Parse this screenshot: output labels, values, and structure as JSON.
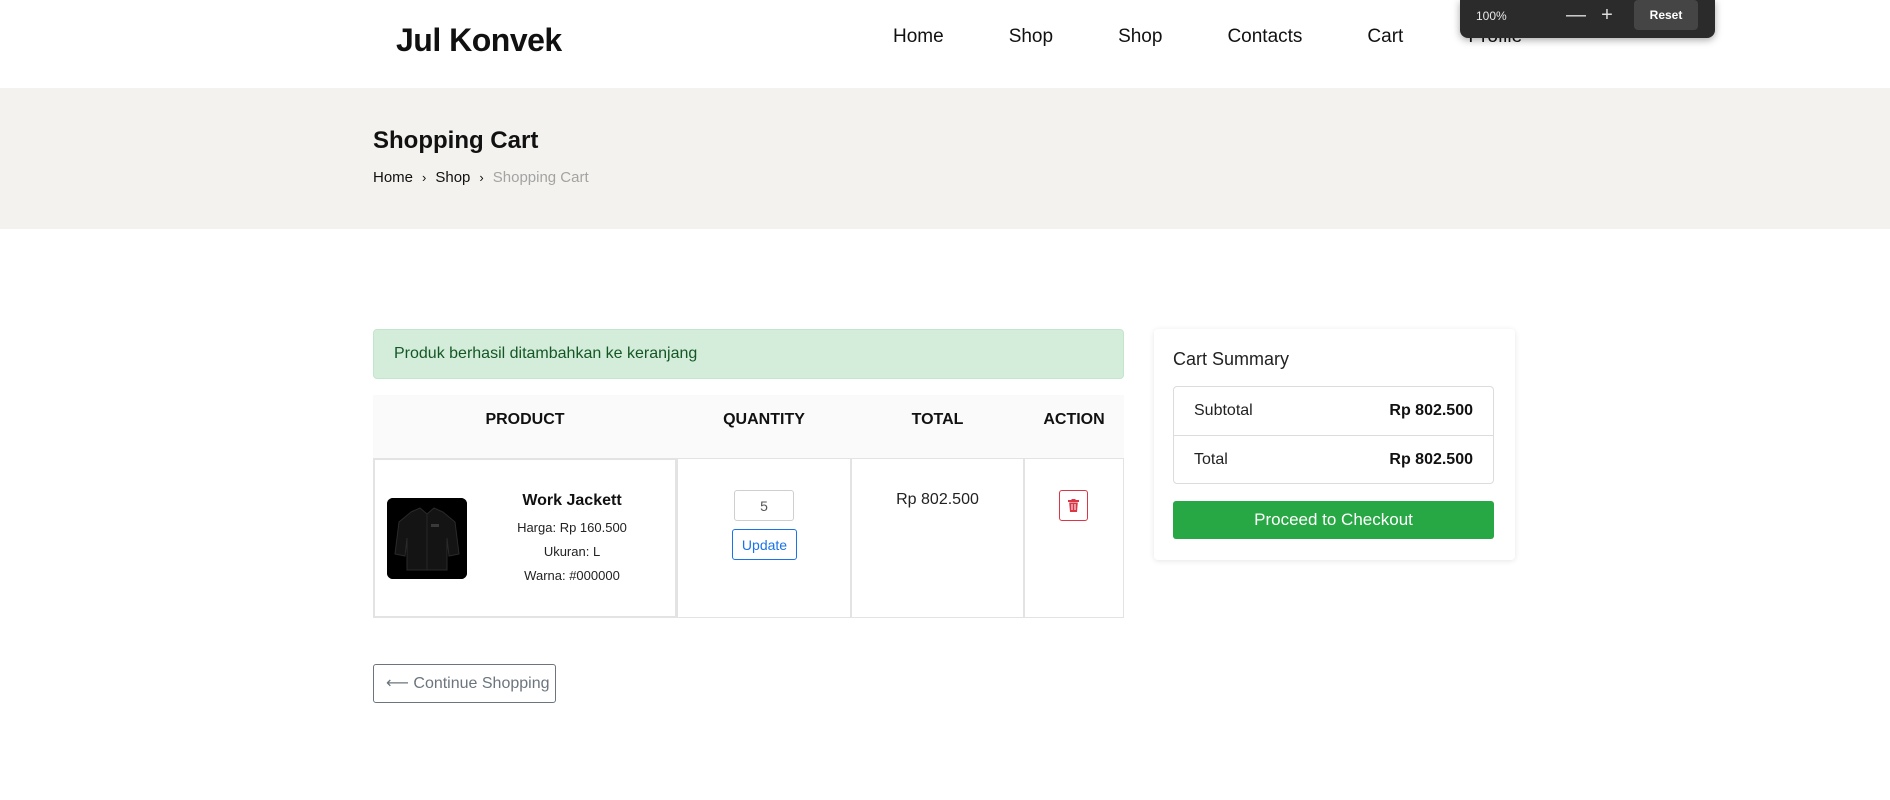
{
  "header": {
    "logo": "Jul Konvek",
    "nav": [
      "Home",
      "Shop",
      "Shop",
      "Contacts",
      "Cart",
      "Profile"
    ]
  },
  "zoom": {
    "level": "100%",
    "minus": "—",
    "plus": "+",
    "reset": "Reset"
  },
  "banner": {
    "title": "Shopping Cart",
    "breadcrumb": [
      "Home",
      "Shop",
      "Shopping Cart"
    ],
    "sep": "›"
  },
  "alert": "Produk berhasil ditambahkan ke keranjang",
  "table": {
    "headers": [
      "PRODUCT",
      "QUANTITY",
      "TOTAL",
      "ACTION"
    ],
    "rows": [
      {
        "name": "Work Jackett",
        "price": "Harga: Rp 160.500",
        "size": "Ukuran: L",
        "color": "Warna: #000000",
        "quantity": "5",
        "update": "Update",
        "total": "Rp 802.500",
        "delete_icon": "trash-icon"
      }
    ]
  },
  "continue": "⟵ Continue Shopping",
  "summary": {
    "title": "Cart Summary",
    "subtotal_label": "Subtotal",
    "subtotal_value": "Rp 802.500",
    "total_label": "Total",
    "total_value": "Rp 802.500",
    "checkout": "Proceed to Checkout"
  },
  "colors": {
    "alert_bg": "#d4eddb",
    "checkout": "#28a745",
    "update_btn": "#1a73e8",
    "delete_btn": "#dc3545",
    "banner_bg": "#f3f2ee"
  }
}
